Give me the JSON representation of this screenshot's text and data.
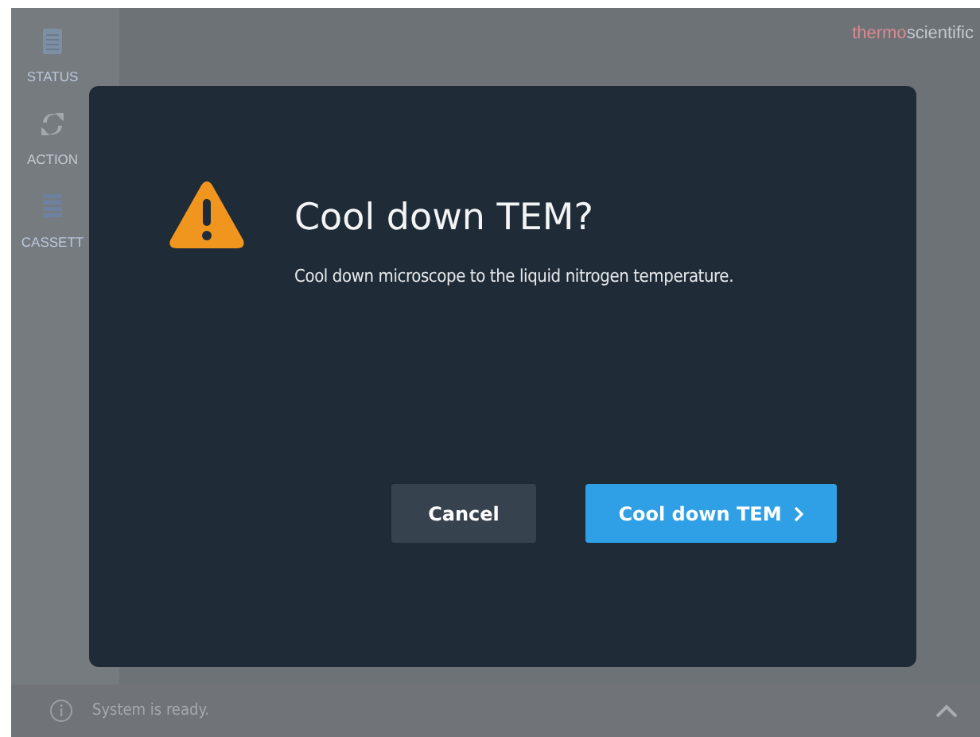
{
  "sidebar": {
    "items": [
      {
        "kind": "status",
        "label": "STATUS"
      },
      {
        "kind": "action",
        "label": "ACTION"
      },
      {
        "kind": "cassette",
        "label": "CASSETT"
      }
    ]
  },
  "brand": {
    "part_1": "thermo",
    "part_2": "scientific"
  },
  "dialog": {
    "title": "Cool down TEM?",
    "message": "Cool down microscope to the liquid nitrogen temperature.",
    "buttons": [
      {
        "kind": "secondary",
        "label": "Cancel"
      },
      {
        "kind": "primary",
        "label": "Cool down TEM"
      }
    ]
  },
  "status_bar": {
    "message": "System is ready."
  }
}
